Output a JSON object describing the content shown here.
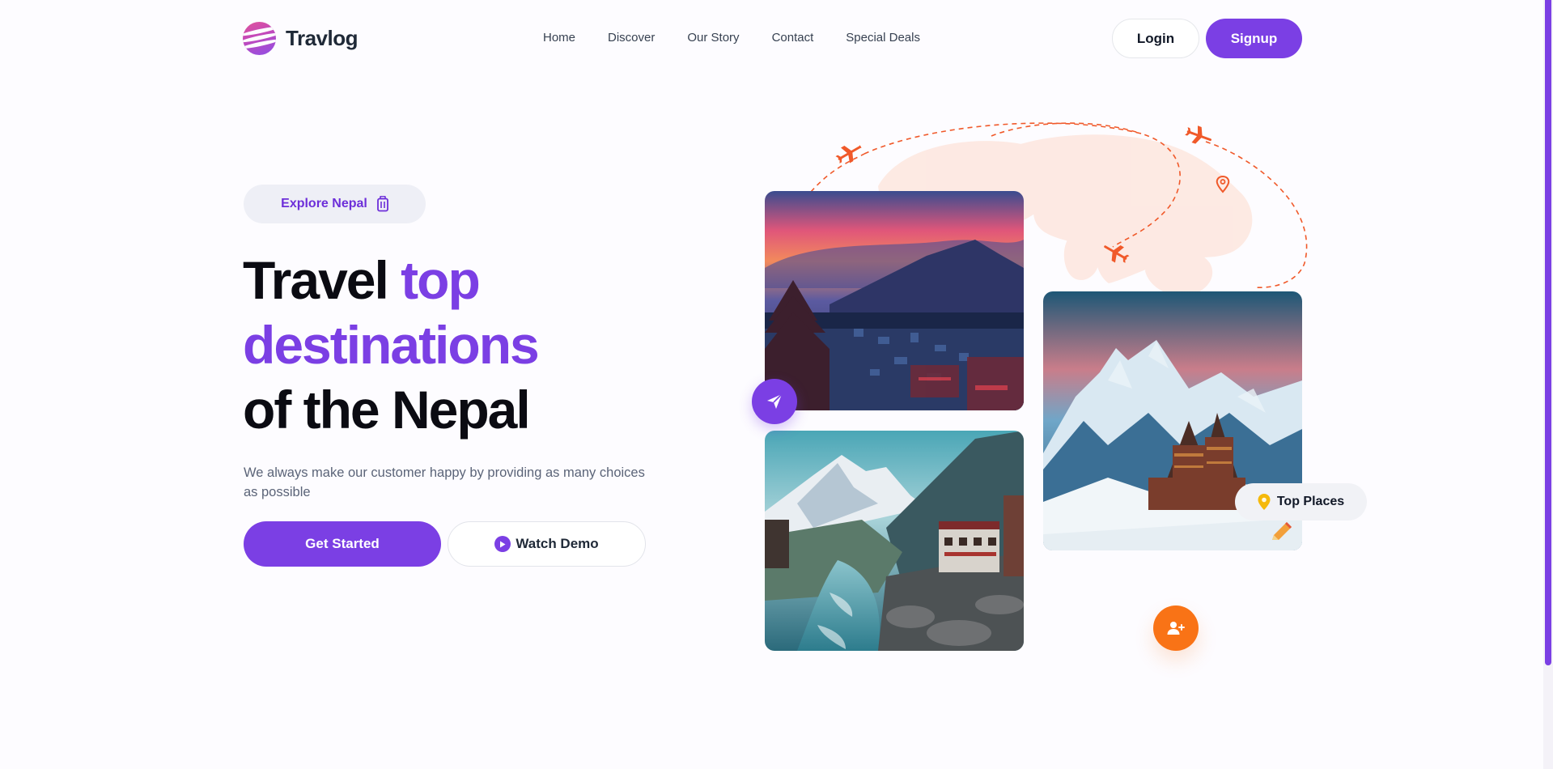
{
  "header": {
    "brand": "Travlog",
    "nav": [
      {
        "label": "Home"
      },
      {
        "label": "Discover"
      },
      {
        "label": "Our Story"
      },
      {
        "label": "Contact"
      },
      {
        "label": "Special Deals"
      }
    ],
    "login_label": "Login",
    "signup_label": "Signup"
  },
  "hero": {
    "pill_label": "Explore Nepal",
    "headline_part1": "Travel ",
    "headline_accent1": "top",
    "headline_accent2": "destinations",
    "headline_part3": "of the Nepal",
    "subtext": "We always make our customer happy by providing as many choices as possible",
    "get_started_label": "Get Started",
    "watch_demo_label": "Watch Demo"
  },
  "badges": {
    "top_places_label": "Top Places"
  },
  "colors": {
    "primary": "#7b3fe4",
    "accent_orange": "#f97316",
    "route_orange": "#f0592a",
    "pin_yellow": "#f5b90b"
  },
  "icons": [
    "luggage-icon",
    "play-icon",
    "send-icon",
    "user-plus-icon",
    "location-pin-icon",
    "pencil-icon",
    "airplane-icon"
  ]
}
